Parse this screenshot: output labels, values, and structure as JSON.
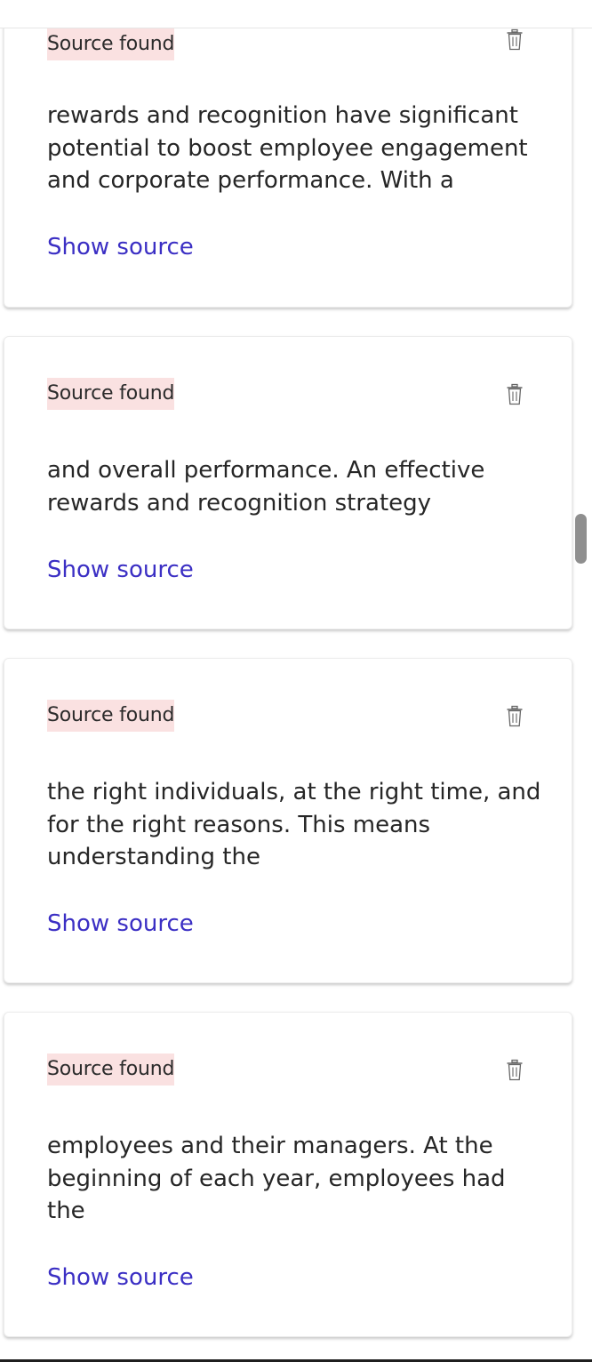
{
  "cards": [
    {
      "badge": "Source found",
      "snippet": "rewards and recognition have significant potential to boost employee engagement and corporate performance. With a",
      "link": "Show source"
    },
    {
      "badge": "Source found",
      "snippet": "and overall performance. An effective rewards and recognition strategy",
      "link": "Show source"
    },
    {
      "badge": "Source found",
      "snippet": "the right individuals, at the right time, and for the right reasons. This means understanding the",
      "link": "Show source"
    },
    {
      "badge": "Source found",
      "snippet": "employees and their managers. At the beginning of each year, employees had the",
      "link": "Show source"
    }
  ],
  "icons": {
    "delete": "trash-icon"
  },
  "colors": {
    "badge_bg": "#fae1e1",
    "link": "#3b2fc4",
    "text": "#262626",
    "scrollbar": "#8f8f8f"
  }
}
